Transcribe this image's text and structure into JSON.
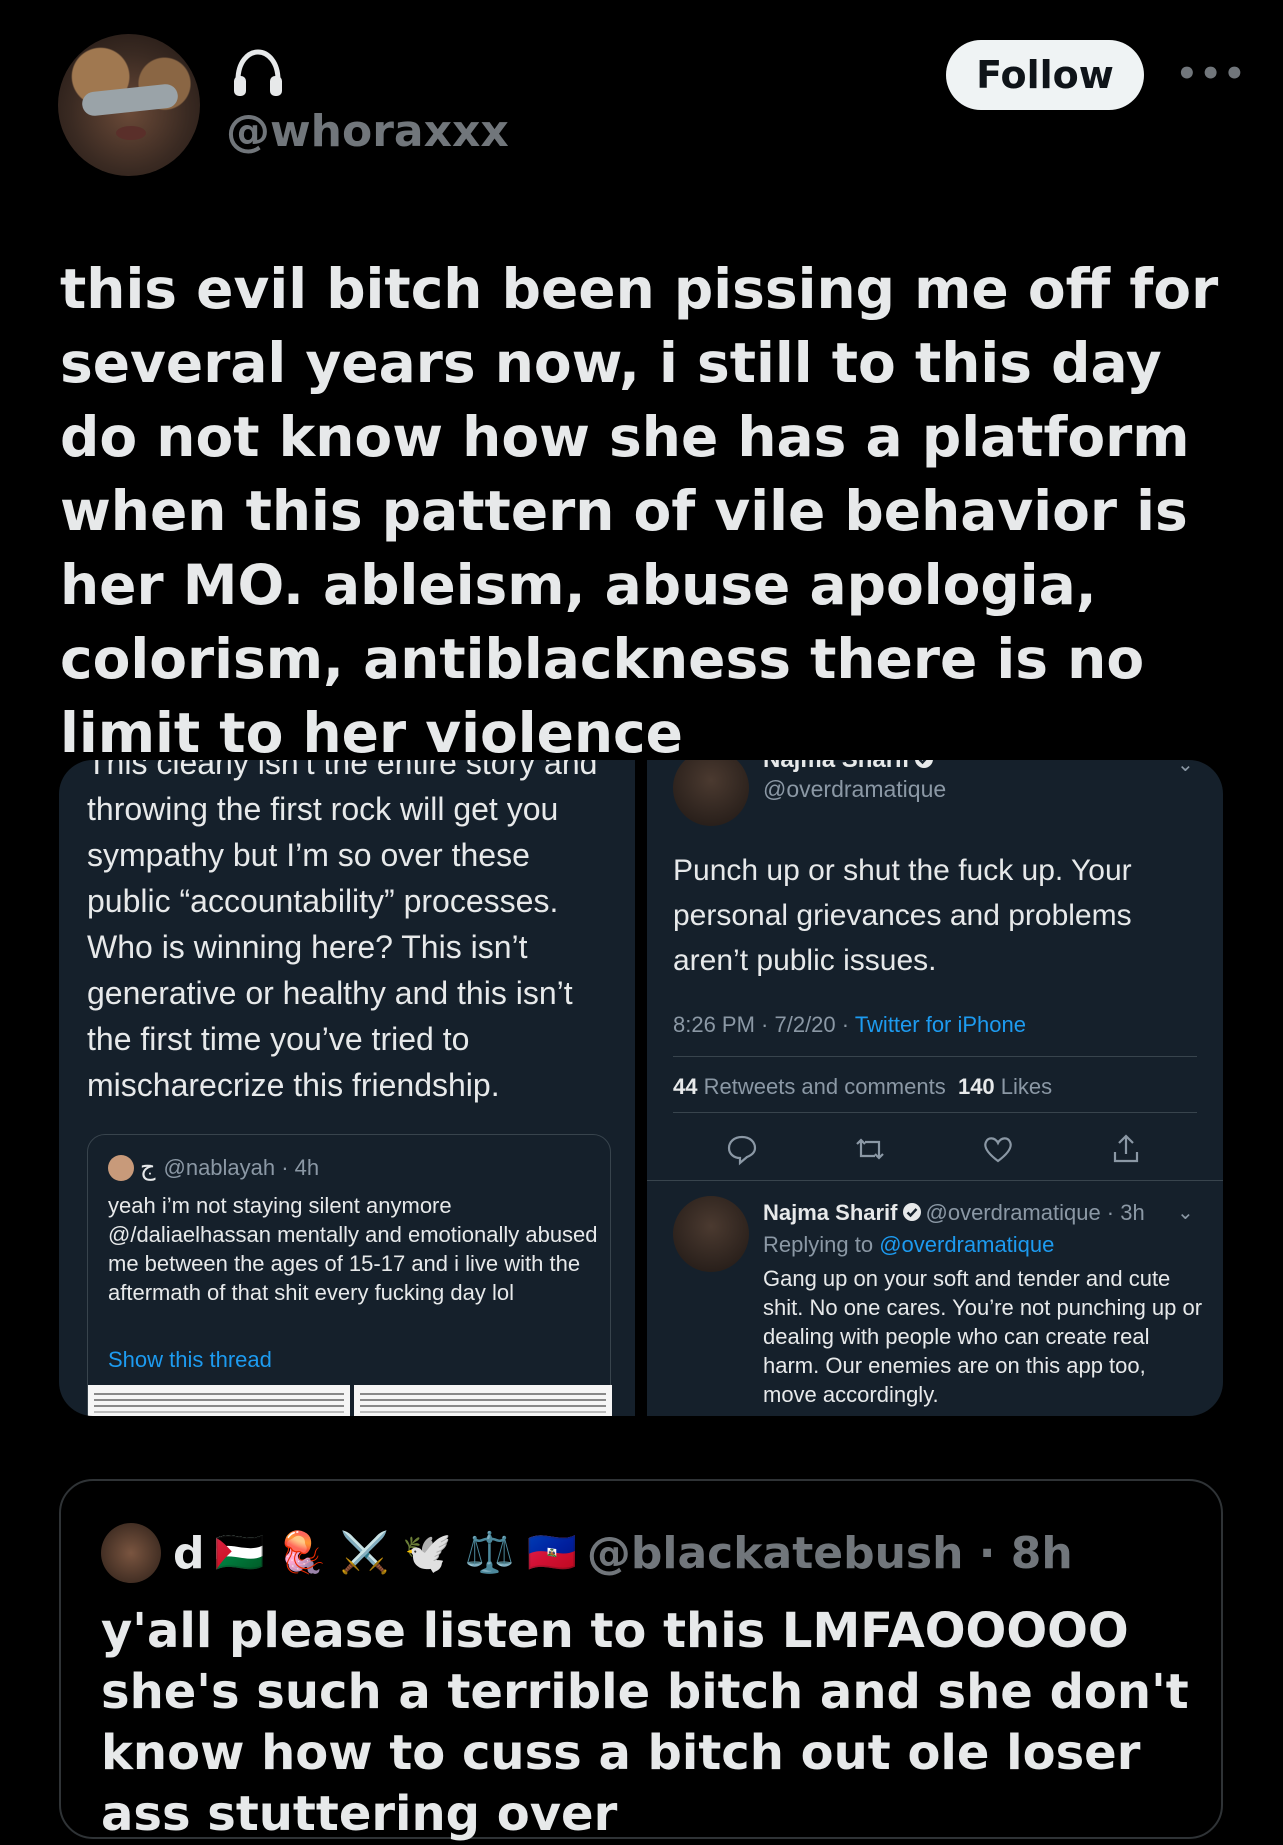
{
  "author": {
    "handle": "@whoraxxx",
    "avatar_icon": "profile-photo",
    "name_icon": "headphones-icon"
  },
  "follow_label": "Follow",
  "more_icon": "more-horizontal-icon",
  "tweet_text": "this evil bitch been pissing me off for several years now, i still to this day do not know how she has a platform when this pattern of vile behavior is her MO. ableism, abuse apologia, colorism, antiblackness there is no limit to her violence",
  "media": {
    "left": {
      "text": "This clearly isn’t the entire story and throwing the first rock will get you sympathy but I’m so over these public “accountability” processes. Who is winning here? This isn’t generative or healthy and this isn’t the first time you’ve tried to mischarecrize this friendship.",
      "quoted": {
        "glyph": "ج",
        "handle_time": "@nablayah · 4h",
        "body": "yeah i’m not staying silent anymore @/daliaelhassan mentally and emotionally abused me between the ages of 15-17 and i live with the aftermath of that shit every fucking day lol",
        "link": "Show this thread"
      }
    },
    "right": {
      "name": "Najma Sharif",
      "handle": "@overdramatique",
      "body": "Punch up or shut the fuck up. Your personal grievances and problems aren’t public issues.",
      "time": "8:26 PM · 7/2/20 · ",
      "source": "Twitter for iPhone",
      "retweets_count": "44",
      "retweets_label": "Retweets and comments",
      "likes_count": "140",
      "likes_label": "Likes",
      "reply": {
        "name": "Najma Sharif",
        "handle_time": "@overdramatique · 3h",
        "replying_label": "Replying to ",
        "replying_to": "@overdramatique",
        "body": "Gang up on your soft and tender and cute shit. No one cares. You’re not punching up or dealing with people who can create real harm. Our enemies are on this app too, move accordingly."
      }
    }
  },
  "quoted_tweet": {
    "name": "d",
    "emojis": "🇵🇸 🪼 ⚔️ 🕊️ ⚖️ 🇭🇹",
    "handle_time": "@blackatebush · 8h",
    "text": "y'all please listen to this LMFAOOOOO she's such a terrible bitch and she don't know how to cuss a bitch out ole loser ass stuttering over"
  },
  "colors": {
    "background": "#000000",
    "text": "#e7e9ea",
    "muted": "#71767b",
    "link": "#1d9bf0",
    "panel": "#15202b"
  }
}
